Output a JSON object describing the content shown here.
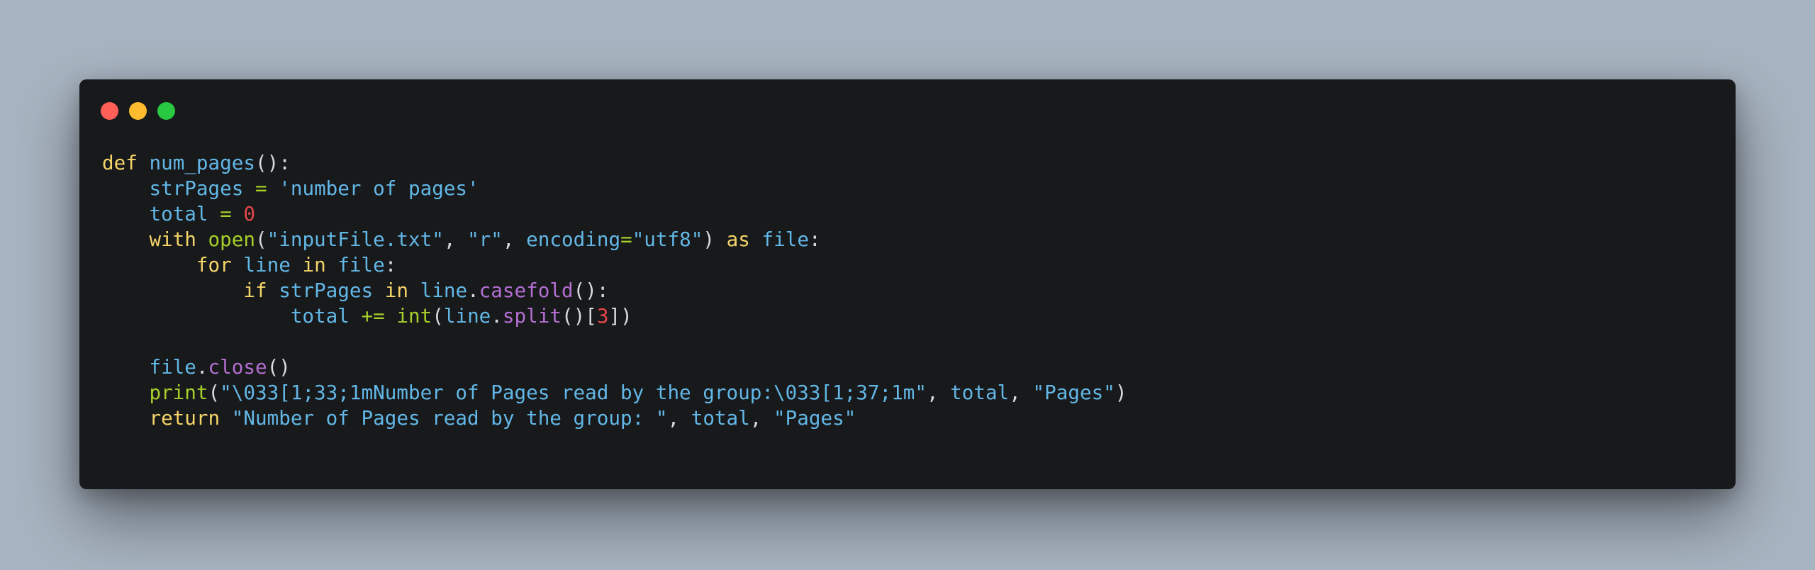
{
  "window": {
    "controls": [
      {
        "name": "close",
        "color": "#ff5f57"
      },
      {
        "name": "minimize",
        "color": "#febc2e"
      },
      {
        "name": "maximize",
        "color": "#28c840"
      }
    ]
  },
  "theme": {
    "background": "#17191b",
    "page_background": "#a8b4c1",
    "colors": {
      "kw": "#f5d469",
      "fn": "#63b7e6",
      "id": "#63b7e6",
      "str": "#63b7e6",
      "num": "#e6474c",
      "op": "#a6cf2a",
      "bi": "#a6cf2a",
      "meth": "#b46fd1",
      "punct": "#d8dade"
    }
  },
  "code": {
    "language": "python",
    "lines": [
      [
        [
          "kw",
          "def"
        ],
        [
          "ws",
          " "
        ],
        [
          "fn",
          "num_pages"
        ],
        [
          "punct",
          "():"
        ]
      ],
      [
        [
          "ws",
          "    "
        ],
        [
          "id",
          "strPages"
        ],
        [
          "ws",
          " "
        ],
        [
          "op",
          "="
        ],
        [
          "ws",
          " "
        ],
        [
          "str",
          "'number of pages'"
        ]
      ],
      [
        [
          "ws",
          "    "
        ],
        [
          "id",
          "total"
        ],
        [
          "ws",
          " "
        ],
        [
          "op",
          "="
        ],
        [
          "ws",
          " "
        ],
        [
          "num",
          "0"
        ]
      ],
      [
        [
          "ws",
          "    "
        ],
        [
          "kw",
          "with"
        ],
        [
          "ws",
          " "
        ],
        [
          "bi",
          "open"
        ],
        [
          "punct",
          "("
        ],
        [
          "str",
          "\"inputFile.txt\""
        ],
        [
          "punct",
          ","
        ],
        [
          "ws",
          " "
        ],
        [
          "str",
          "\"r\""
        ],
        [
          "punct",
          ","
        ],
        [
          "ws",
          " "
        ],
        [
          "id",
          "encoding"
        ],
        [
          "op",
          "="
        ],
        [
          "str",
          "\"utf8\""
        ],
        [
          "punct",
          ")"
        ],
        [
          "ws",
          " "
        ],
        [
          "kw",
          "as"
        ],
        [
          "ws",
          " "
        ],
        [
          "id",
          "file"
        ],
        [
          "punct",
          ":"
        ]
      ],
      [
        [
          "ws",
          "        "
        ],
        [
          "kw",
          "for"
        ],
        [
          "ws",
          " "
        ],
        [
          "id",
          "line"
        ],
        [
          "ws",
          " "
        ],
        [
          "kw",
          "in"
        ],
        [
          "ws",
          " "
        ],
        [
          "id",
          "file"
        ],
        [
          "punct",
          ":"
        ]
      ],
      [
        [
          "ws",
          "            "
        ],
        [
          "kw",
          "if"
        ],
        [
          "ws",
          " "
        ],
        [
          "id",
          "strPages"
        ],
        [
          "ws",
          " "
        ],
        [
          "kw",
          "in"
        ],
        [
          "ws",
          " "
        ],
        [
          "id",
          "line"
        ],
        [
          "punct",
          "."
        ],
        [
          "meth",
          "casefold"
        ],
        [
          "punct",
          "():"
        ]
      ],
      [
        [
          "ws",
          "                "
        ],
        [
          "id",
          "total"
        ],
        [
          "ws",
          " "
        ],
        [
          "op",
          "+="
        ],
        [
          "ws",
          " "
        ],
        [
          "bi",
          "int"
        ],
        [
          "punct",
          "("
        ],
        [
          "id",
          "line"
        ],
        [
          "punct",
          "."
        ],
        [
          "meth",
          "split"
        ],
        [
          "punct",
          "()["
        ],
        [
          "num",
          "3"
        ],
        [
          "punct",
          "])"
        ]
      ],
      [],
      [
        [
          "ws",
          "    "
        ],
        [
          "id",
          "file"
        ],
        [
          "punct",
          "."
        ],
        [
          "meth",
          "close"
        ],
        [
          "punct",
          "()"
        ]
      ],
      [
        [
          "ws",
          "    "
        ],
        [
          "bi",
          "print"
        ],
        [
          "punct",
          "("
        ],
        [
          "str",
          "\"\\033[1;33;1mNumber of Pages read by the group:\\033[1;37;1m\""
        ],
        [
          "punct",
          ","
        ],
        [
          "ws",
          " "
        ],
        [
          "id",
          "total"
        ],
        [
          "punct",
          ","
        ],
        [
          "ws",
          " "
        ],
        [
          "str",
          "\"Pages\""
        ],
        [
          "punct",
          ")"
        ]
      ],
      [
        [
          "ws",
          "    "
        ],
        [
          "kw",
          "return"
        ],
        [
          "ws",
          " "
        ],
        [
          "str",
          "\"Number of Pages read by the group: \""
        ],
        [
          "punct",
          ","
        ],
        [
          "ws",
          " "
        ],
        [
          "id",
          "total"
        ],
        [
          "punct",
          ","
        ],
        [
          "ws",
          " "
        ],
        [
          "str",
          "\"Pages\""
        ]
      ]
    ]
  }
}
